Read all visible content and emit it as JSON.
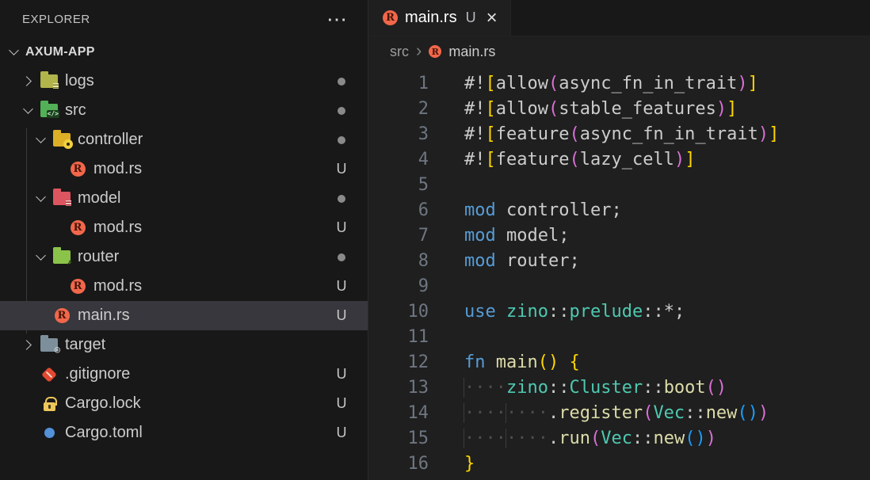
{
  "colors": {
    "sidebar_bg": "#181818",
    "editor_bg": "#1f1f1f",
    "tabbar_bg": "#181818",
    "selected_row_bg": "#37373d",
    "rust_orange": "#f2674b",
    "keyword": "#569cd6",
    "type": "#4ec9b0",
    "function": "#dcdcaa",
    "bracket_level1": "#ffd700",
    "bracket_level2": "#da70d6",
    "bracket_level3": "#179fff",
    "text": "#cccccc",
    "line_number": "#6e7681"
  },
  "icons": {
    "rust_letter": "R",
    "more": "⋯",
    "breadcrumb_separator": "›",
    "router_arrow": "↗",
    "target_glyph": "◎",
    "src_glyph": "</>"
  },
  "sidebar": {
    "header": {
      "title": "EXPLORER"
    },
    "root": {
      "label": "AXUM-APP"
    },
    "items": [
      {
        "label": "logs",
        "kind": "folder",
        "depth": 1,
        "expanded": false,
        "icon": "folder-logs",
        "badge": "dot",
        "selected": false
      },
      {
        "label": "src",
        "kind": "folder",
        "depth": 1,
        "expanded": true,
        "icon": "folder-src",
        "badge": "dot",
        "selected": false
      },
      {
        "label": "controller",
        "kind": "folder",
        "depth": 2,
        "expanded": true,
        "icon": "folder-ctrl",
        "badge": "dot",
        "selected": false
      },
      {
        "label": "mod.rs",
        "kind": "file",
        "depth": 3,
        "icon": "rust",
        "badge": "U",
        "selected": false
      },
      {
        "label": "model",
        "kind": "folder",
        "depth": 2,
        "expanded": true,
        "icon": "folder-model",
        "badge": "dot",
        "selected": false
      },
      {
        "label": "mod.rs",
        "kind": "file",
        "depth": 3,
        "icon": "rust",
        "badge": "U",
        "selected": false
      },
      {
        "label": "router",
        "kind": "folder",
        "depth": 2,
        "expanded": true,
        "icon": "folder-router",
        "badge": "dot",
        "selected": false
      },
      {
        "label": "mod.rs",
        "kind": "file",
        "depth": 3,
        "icon": "rust",
        "badge": "U",
        "selected": false
      },
      {
        "label": "main.rs",
        "kind": "file",
        "depth": 2,
        "icon": "rust",
        "badge": "U",
        "selected": true
      },
      {
        "label": "target",
        "kind": "folder",
        "depth": 1,
        "expanded": false,
        "icon": "folder-target",
        "badge": null,
        "selected": false
      },
      {
        "label": ".gitignore",
        "kind": "file",
        "depth": 1,
        "icon": "git",
        "badge": "U",
        "selected": false
      },
      {
        "label": "Cargo.lock",
        "kind": "file",
        "depth": 1,
        "icon": "lock",
        "badge": "U",
        "selected": false
      },
      {
        "label": "Cargo.toml",
        "kind": "file",
        "depth": 1,
        "icon": "gear",
        "badge": "U",
        "selected": false
      }
    ]
  },
  "editor": {
    "tab": {
      "title": "main.rs",
      "dirty_indicator": "U",
      "close": "×"
    },
    "breadcrumb": {
      "segments": [
        "src",
        "main.rs"
      ],
      "separator": "›"
    },
    "code": {
      "language": "rust",
      "lines": [
        {
          "n": "1",
          "tokens": [
            [
              "#!",
              "tx"
            ],
            [
              "[",
              "b1"
            ],
            [
              "allow",
              "tx"
            ],
            [
              "(",
              "b2"
            ],
            [
              "async_fn_in_trait",
              "tx"
            ],
            [
              ")",
              "b2"
            ],
            [
              "]",
              "b1"
            ]
          ]
        },
        {
          "n": "2",
          "tokens": [
            [
              "#!",
              "tx"
            ],
            [
              "[",
              "b1"
            ],
            [
              "allow",
              "tx"
            ],
            [
              "(",
              "b2"
            ],
            [
              "stable_features",
              "tx"
            ],
            [
              ")",
              "b2"
            ],
            [
              "]",
              "b1"
            ]
          ]
        },
        {
          "n": "3",
          "tokens": [
            [
              "#!",
              "tx"
            ],
            [
              "[",
              "b1"
            ],
            [
              "feature",
              "tx"
            ],
            [
              "(",
              "b2"
            ],
            [
              "async_fn_in_trait",
              "tx"
            ],
            [
              ")",
              "b2"
            ],
            [
              "]",
              "b1"
            ]
          ]
        },
        {
          "n": "4",
          "tokens": [
            [
              "#!",
              "tx"
            ],
            [
              "[",
              "b1"
            ],
            [
              "feature",
              "tx"
            ],
            [
              "(",
              "b2"
            ],
            [
              "lazy_cell",
              "tx"
            ],
            [
              ")",
              "b2"
            ],
            [
              "]",
              "b1"
            ]
          ]
        },
        {
          "n": "5",
          "tokens": []
        },
        {
          "n": "6",
          "tokens": [
            [
              "mod",
              "kw"
            ],
            [
              " controller;",
              "tx"
            ]
          ]
        },
        {
          "n": "7",
          "tokens": [
            [
              "mod",
              "kw"
            ],
            [
              " model;",
              "tx"
            ]
          ]
        },
        {
          "n": "8",
          "tokens": [
            [
              "mod",
              "kw"
            ],
            [
              " router;",
              "tx"
            ]
          ]
        },
        {
          "n": "9",
          "tokens": []
        },
        {
          "n": "10",
          "tokens": [
            [
              "use",
              "kw"
            ],
            [
              " ",
              "tx"
            ],
            [
              "zino",
              "ty"
            ],
            [
              "::",
              "tx"
            ],
            [
              "prelude",
              "ty"
            ],
            [
              "::*;",
              "tx"
            ]
          ]
        },
        {
          "n": "11",
          "tokens": []
        },
        {
          "n": "12",
          "tokens": [
            [
              "fn",
              "kw"
            ],
            [
              " ",
              "tx"
            ],
            [
              "main",
              "fn"
            ],
            [
              "(",
              "b1"
            ],
            [
              ")",
              "b1"
            ],
            [
              " ",
              "tx"
            ],
            [
              "{",
              "b1"
            ]
          ]
        },
        {
          "n": "13",
          "tokens": [
            [
              "····",
              "ws ig"
            ],
            [
              "zino",
              "ty"
            ],
            [
              "::",
              "tx"
            ],
            [
              "Cluster",
              "ty"
            ],
            [
              "::",
              "tx"
            ],
            [
              "boot",
              "fn"
            ],
            [
              "(",
              "b2"
            ],
            [
              ")",
              "b2"
            ]
          ]
        },
        {
          "n": "14",
          "tokens": [
            [
              "····",
              "ws ig"
            ],
            [
              "····",
              "ws ig"
            ],
            [
              ".",
              "tx"
            ],
            [
              "register",
              "fn"
            ],
            [
              "(",
              "b2"
            ],
            [
              "Vec",
              "ty"
            ],
            [
              "::",
              "tx"
            ],
            [
              "new",
              "fn"
            ],
            [
              "(",
              "b3"
            ],
            [
              ")",
              "b3"
            ],
            [
              ")",
              "b2"
            ]
          ]
        },
        {
          "n": "15",
          "tokens": [
            [
              "····",
              "ws ig"
            ],
            [
              "····",
              "ws ig"
            ],
            [
              ".",
              "tx"
            ],
            [
              "run",
              "fn"
            ],
            [
              "(",
              "b2"
            ],
            [
              "Vec",
              "ty"
            ],
            [
              "::",
              "tx"
            ],
            [
              "new",
              "fn"
            ],
            [
              "(",
              "b3"
            ],
            [
              ")",
              "b3"
            ],
            [
              ")",
              "b2"
            ]
          ]
        },
        {
          "n": "16",
          "tokens": [
            [
              "}",
              "b1"
            ]
          ]
        }
      ]
    }
  }
}
